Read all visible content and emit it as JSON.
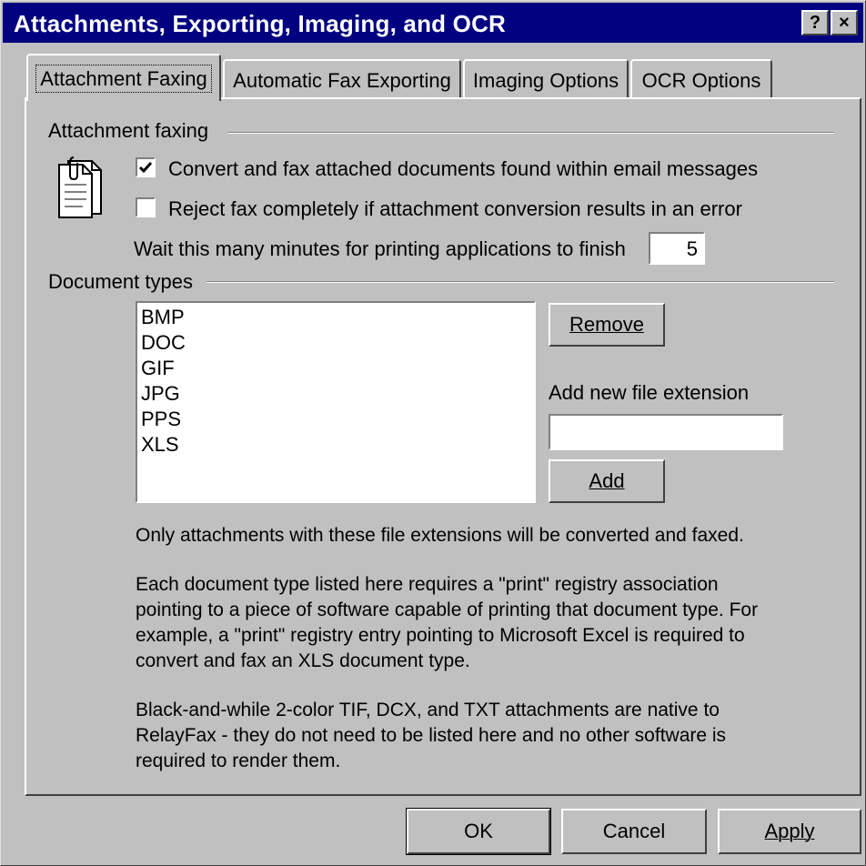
{
  "window": {
    "title": "Attachments, Exporting, Imaging, and OCR",
    "help_button": "?",
    "close_button": "×"
  },
  "tabs": [
    {
      "label": "Attachment Faxing",
      "active": true
    },
    {
      "label": "Automatic Fax Exporting",
      "active": false
    },
    {
      "label": "Imaging Options",
      "active": false
    },
    {
      "label": "OCR Options",
      "active": false
    }
  ],
  "attachment_group": {
    "heading": "Attachment faxing",
    "convert_checkbox": {
      "label": "Convert and fax attached documents found within email messages",
      "checked": true
    },
    "reject_checkbox": {
      "label": "Reject fax completely if attachment conversion results in an error",
      "checked": false
    },
    "wait_label": "Wait this many minutes for printing applications to finish",
    "wait_value": "5"
  },
  "doc_types": {
    "heading": "Document types",
    "items": [
      "BMP",
      "DOC",
      "GIF",
      "JPG",
      "PPS",
      "XLS"
    ],
    "remove_button": "Remove",
    "add_ext_label": "Add new file extension",
    "add_ext_value": "",
    "add_button": "Add"
  },
  "info": {
    "line1": "Only attachments with these file extensions will be converted and faxed.",
    "para2": [
      "Each document type listed here requires a \"print\" registry association",
      "pointing to a piece of software capable of printing that document type.  For",
      "example, a \"print\" registry entry pointing to Microsoft Excel is required to",
      "convert and fax an XLS document type."
    ],
    "para3": [
      "Black-and-while 2-color TIF, DCX, and TXT attachments are native to",
      "RelayFax - they do not need to be listed here and no other software is",
      "required to render them."
    ]
  },
  "footer": {
    "ok": "OK",
    "cancel": "Cancel",
    "apply": "Apply"
  }
}
